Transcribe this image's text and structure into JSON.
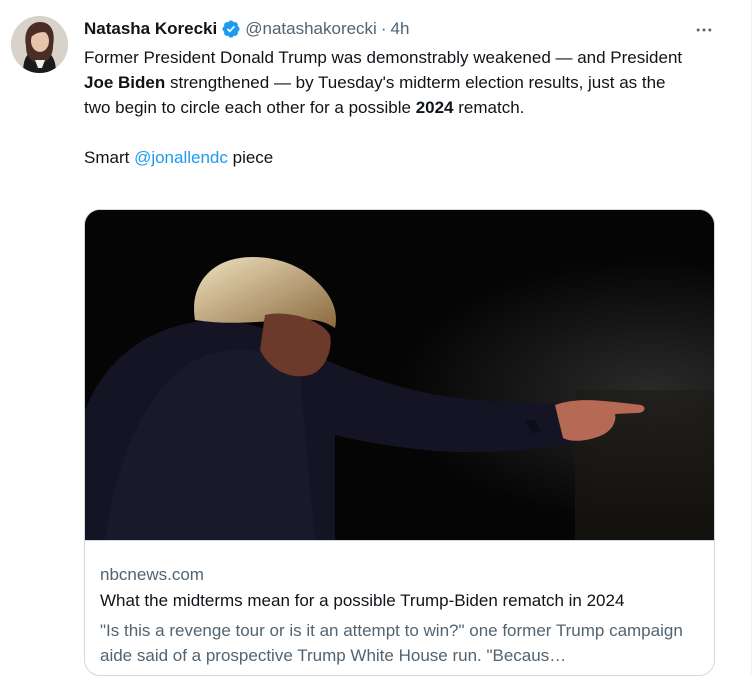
{
  "author": {
    "name": "Natasha Korecki",
    "handle": "@natashakorecki",
    "separator": "·",
    "time": "4h",
    "verified": true,
    "verified_icon": "verified-badge-icon",
    "verified_color": "#1d9bf0"
  },
  "more_icon": "more-options-icon",
  "tweet": {
    "p1_a": "Former President Donald Trump was demonstrably weakened — and President ",
    "p1_b": "Joe Biden",
    "p1_c": " strengthened — by Tuesday's midterm election results, just as the two begin to circle each other for a possible ",
    "p1_d": "2024",
    "p1_e": " rematch.",
    "p2_a": "Smart ",
    "p2_mention": "@jonallendc",
    "p2_b": " piece"
  },
  "card": {
    "domain": "nbcnews.com",
    "title": "What the midterms mean for a possible Trump-Biden rematch in 2024",
    "description": "\"Is this a revenge tour or is it an attempt to win?\" one former Trump campaign aide said of a prospective Trump White House run. \"Becaus…"
  },
  "colors": {
    "link": "#1d9bf0",
    "secondary_text": "#536471",
    "primary_text": "#0f1419",
    "border": "#cfd9de"
  }
}
